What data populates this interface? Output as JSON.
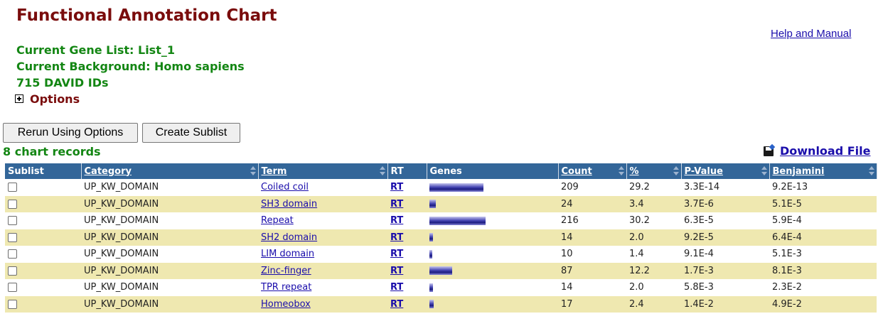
{
  "page": {
    "title": "Functional Annotation Chart",
    "help_link": "Help and Manual",
    "gene_list": "Current Gene List: List_1",
    "background": "Current Background: Homo sapiens",
    "ids": "715 DAVID IDs",
    "options": "Options"
  },
  "toolbar": {
    "rerun_label": "Rerun Using Options",
    "sublist_label": "Create Sublist"
  },
  "records_text": "8 chart records",
  "download_label": "Download File",
  "table": {
    "headers": {
      "sublist": "Sublist",
      "category": "Category",
      "term": "Term",
      "rt": "RT",
      "genes": "Genes",
      "count": "Count",
      "percent": "%",
      "pvalue": "P-Value",
      "benjamini": "Benjamini"
    },
    "rows": [
      {
        "category": "UP_KW_DOMAIN",
        "term": "Coiled coil",
        "rt": "RT",
        "count": "209",
        "percent": "29.2",
        "pvalue": "3.3E-14",
        "benjamini": "9.2E-13"
      },
      {
        "category": "UP_KW_DOMAIN",
        "term": "SH3 domain",
        "rt": "RT",
        "count": "24",
        "percent": "3.4",
        "pvalue": "3.7E-6",
        "benjamini": "5.1E-5"
      },
      {
        "category": "UP_KW_DOMAIN",
        "term": "Repeat",
        "rt": "RT",
        "count": "216",
        "percent": "30.2",
        "pvalue": "6.3E-5",
        "benjamini": "5.9E-4"
      },
      {
        "category": "UP_KW_DOMAIN",
        "term": "SH2 domain",
        "rt": "RT",
        "count": "14",
        "percent": "2.0",
        "pvalue": "9.2E-5",
        "benjamini": "6.4E-4"
      },
      {
        "category": "UP_KW_DOMAIN",
        "term": "LIM domain",
        "rt": "RT",
        "count": "10",
        "percent": "1.4",
        "pvalue": "9.1E-4",
        "benjamini": "5.1E-3"
      },
      {
        "category": "UP_KW_DOMAIN",
        "term": "Zinc-finger",
        "rt": "RT",
        "count": "87",
        "percent": "12.2",
        "pvalue": "1.7E-3",
        "benjamini": "8.1E-3"
      },
      {
        "category": "UP_KW_DOMAIN",
        "term": "TPR repeat",
        "rt": "RT",
        "count": "14",
        "percent": "2.0",
        "pvalue": "5.8E-3",
        "benjamini": "2.3E-2"
      },
      {
        "category": "UP_KW_DOMAIN",
        "term": "Homeobox",
        "rt": "RT",
        "count": "17",
        "percent": "2.4",
        "pvalue": "1.4E-2",
        "benjamini": "4.9E-2"
      }
    ]
  },
  "colors": {
    "title": "#7a0c0c",
    "info": "#138613",
    "header_bg": "#336699",
    "row_alt": "#efe8b0",
    "link": "#1a0dab"
  }
}
